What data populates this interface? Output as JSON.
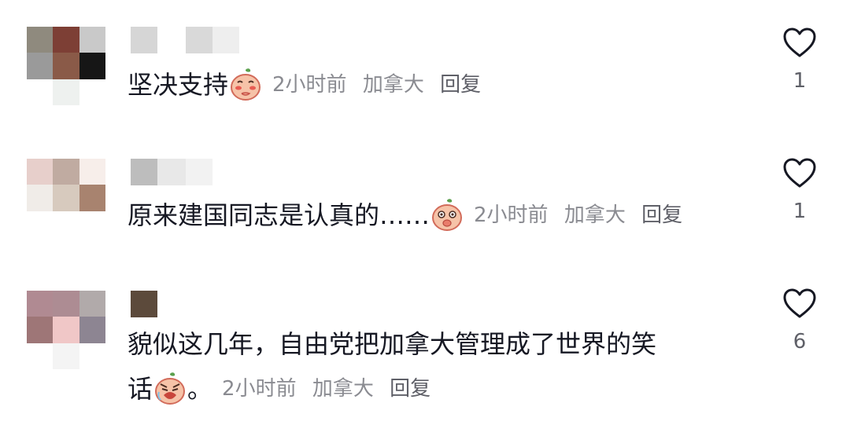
{
  "comments": [
    {
      "text": "坚决支持",
      "emoji": "shy-peach-emoji",
      "time": "2小时前",
      "location": "加拿大",
      "reply_label": "回复",
      "likes": "1",
      "avatar_colors": [
        "#8f8a7e",
        "#7d3f35",
        "#c9c9c9",
        "#9a9a9a",
        "#8a5a48",
        "#161616",
        "#ffffff",
        "#eef1ef",
        "#ffffff"
      ],
      "name_colors": [
        "#d6d6d6",
        "#ffffff",
        "#d9d9d9",
        "#eeeeee"
      ]
    },
    {
      "text": "原来建国同志是认真的……",
      "emoji": "surprised-peach-emoji",
      "time": "2小时前",
      "location": "加拿大",
      "reply_label": "回复",
      "likes": "1",
      "avatar_colors": [
        "#e7cfcb",
        "#c0aba1",
        "#f7eeea",
        "#f0ece8",
        "#d7cabe",
        "#a8836f",
        "#ffffff",
        "#ffffff",
        "#ffffff"
      ],
      "name_colors": [
        "#bdbdbd",
        "#e8e8e8",
        "#f2f2f2"
      ]
    },
    {
      "text_line1": "貌似这几年，自由党把加拿大管理成了世界的笑",
      "text_line2": "话",
      "emoji": "crying-peach-emoji",
      "punct": "。",
      "time": "2小时前",
      "location": "加拿大",
      "reply_label": "回复",
      "likes": "6",
      "avatar_colors": [
        "#b08a92",
        "#ad8c93",
        "#b1aaaa",
        "#9e7677",
        "#f0c7c7",
        "#8d8592",
        "#ffffff",
        "#f4f4f4",
        "#ffffff"
      ],
      "name_colors": [
        "#5c4a3b",
        "#ffffff"
      ]
    }
  ]
}
